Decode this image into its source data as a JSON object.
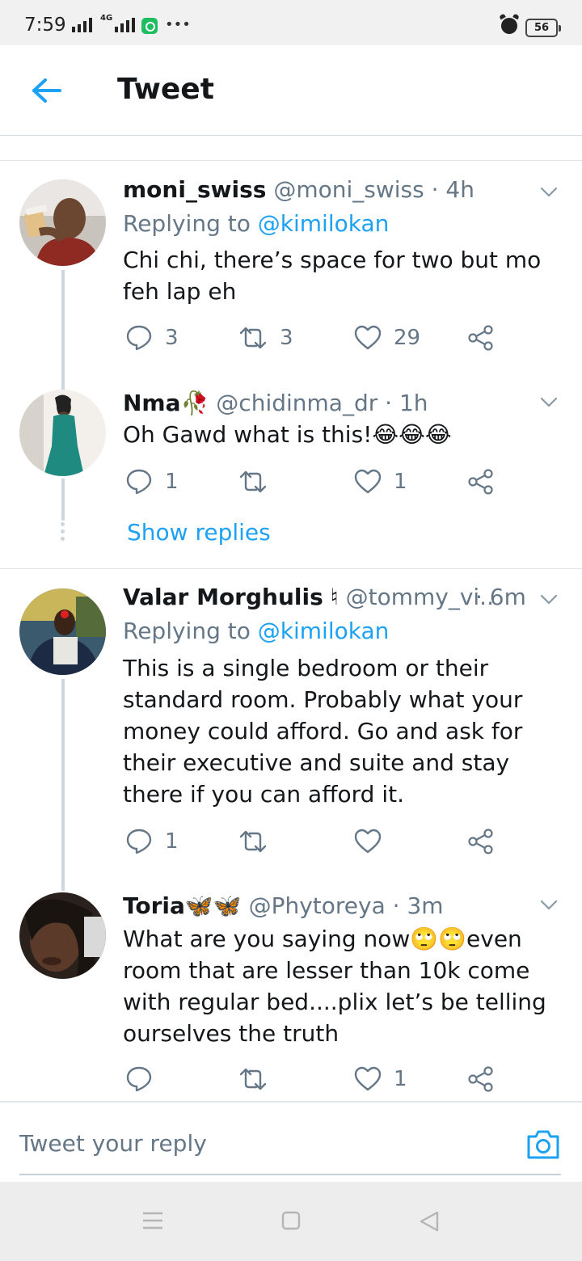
{
  "status_bar": {
    "time": "7:59",
    "network": "4G",
    "battery": "56",
    "icons": [
      "signal-icon",
      "signal-4g-icon",
      "app-notification-icon",
      "more-dots-icon",
      "alarm-icon",
      "battery-icon"
    ]
  },
  "header": {
    "title": "Tweet",
    "back_icon": "arrow-left-icon"
  },
  "tweets": [
    {
      "name": "moni_swiss",
      "handle": "@moni_swiss",
      "time": "· 4h",
      "replying_prefix": "Replying to",
      "replying_to": "@kimilokan",
      "text": "Chi chi, there’s space for two but mo feh lap eh",
      "replies": "3",
      "retweets": "3",
      "likes": "29"
    },
    {
      "name": "Nma",
      "name_emoji": "🥀",
      "handle": "@chidinma_dr",
      "time": "· 1h",
      "text": "Oh Gawd what is this!😂😂😂",
      "replies": "1",
      "retweets": "",
      "likes": "1",
      "show_replies": "Show replies"
    },
    {
      "name": "Valar Morghulis",
      "name_emoji": "♮",
      "handle": "@tommy_vi...",
      "time": "· 6m",
      "replying_prefix": "Replying to",
      "replying_to": "@kimilokan",
      "text": "This is a single bedroom or their standard room. Probably what your money could afford. Go and ask for their executive and suite and stay there if you can afford it.",
      "replies": "1",
      "retweets": "",
      "likes": ""
    },
    {
      "name": "Toria",
      "name_emoji": "🦋🦋",
      "handle": "@Phytoreya",
      "time": "· 3m",
      "text": "What are you saying now🙄🙄even room that are lesser than 10k come with regular bed....plix let’s be telling ourselves the truth",
      "replies": "",
      "retweets": "",
      "likes": "1"
    }
  ],
  "reply_bar": {
    "placeholder": "Tweet your reply",
    "camera_icon": "camera-icon"
  },
  "nav_bar": {
    "icons": [
      "menu-icon",
      "home-square-icon",
      "back-triangle-icon"
    ]
  },
  "colors": {
    "accent": "#1da1f2",
    "muted": "#657786",
    "text": "#14171a",
    "divider": "#e1e6ea"
  }
}
